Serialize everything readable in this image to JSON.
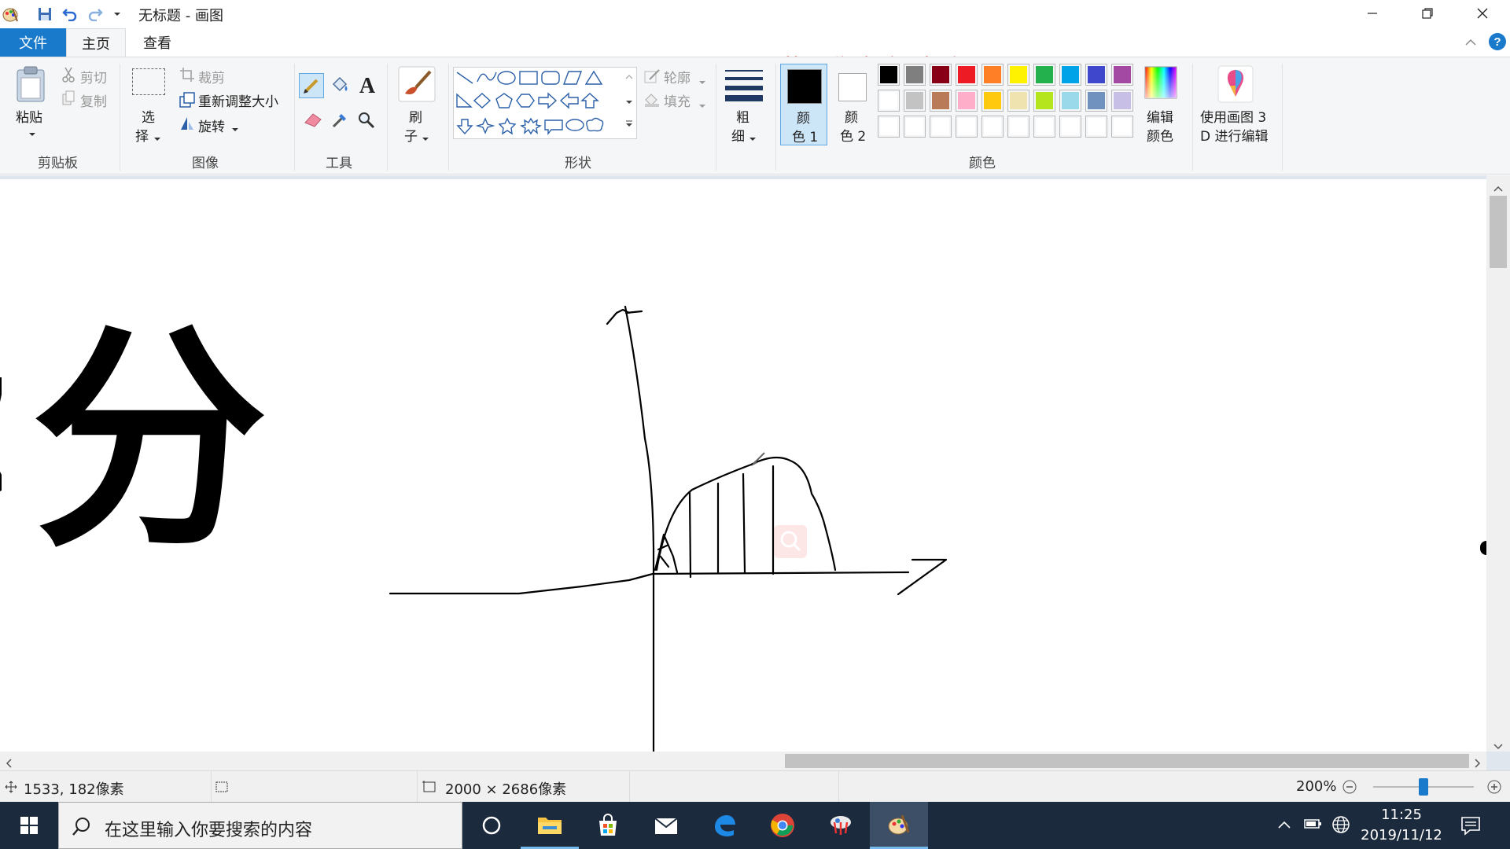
{
  "window": {
    "title": "无标题 - 画图"
  },
  "watermark": "屏幕录像专家  未注册",
  "tabs": {
    "file": "文件",
    "home": "主页",
    "view": "查看"
  },
  "ribbon": {
    "clipboard": {
      "label": "剪贴板",
      "paste": "粘贴",
      "cut": "剪切",
      "copy": "复制"
    },
    "image": {
      "label": "图像",
      "select_line1": "选",
      "select_line2": "择",
      "crop": "裁剪",
      "resize": "重新调整大小",
      "rotate": "旋转"
    },
    "tools": {
      "label": "工具"
    },
    "brushes": {
      "line1": "刷",
      "line2": "子"
    },
    "shapes": {
      "label": "形状",
      "outline": "轮廓",
      "fill": "填充"
    },
    "size": {
      "line1": "粗",
      "line2": "细"
    },
    "colors": {
      "label": "颜色",
      "color1_line1": "颜",
      "color1_line2": "色 1",
      "color2_line1": "颜",
      "color2_line2": "色 2",
      "edit_line1": "编辑",
      "edit_line2": "颜色",
      "color1_value": "#000000",
      "color2_value": "#ffffff",
      "palette_row1": [
        "#000000",
        "#7f7f7f",
        "#880015",
        "#ed1c24",
        "#ff7f27",
        "#fff200",
        "#22b14c",
        "#00a2e8",
        "#3f48cc",
        "#a349a4"
      ],
      "palette_row2": [
        "#ffffff",
        "#c3c3c3",
        "#b97a57",
        "#ffaec9",
        "#ffc90e",
        "#efe4b0",
        "#b5e61d",
        "#99d9ea",
        "#7092be",
        "#c8bfe7"
      ],
      "palette_row3": [
        "#ffffff",
        "#ffffff",
        "#ffffff",
        "#ffffff",
        "#ffffff",
        "#ffffff",
        "#ffffff",
        "#ffffff",
        "#ffffff",
        "#ffffff"
      ]
    },
    "paint3d": {
      "line1": "使用画图 3",
      "line2": "D 进行编辑"
    }
  },
  "canvas": {
    "text": "分"
  },
  "status": {
    "cursor_pos": "1533, 182像素",
    "canvas_size": "2000 × 2686像素",
    "zoom": "200%",
    "zoom_fraction": 0.5
  },
  "taskbar": {
    "search_placeholder": "在这里输入你要搜索的内容",
    "time": "11:25",
    "date": "2019/11/12"
  }
}
